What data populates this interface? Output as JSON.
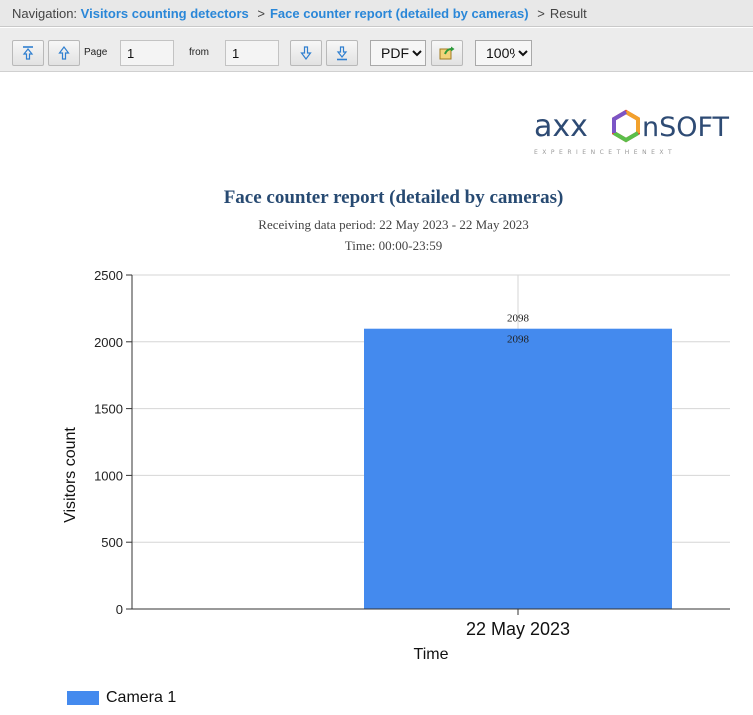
{
  "navigation": {
    "prefix": "Navigation:",
    "items": [
      "Visitors counting detectors",
      "Face counter report (detailed by cameras)"
    ],
    "separator": ">",
    "current": "Result"
  },
  "toolbar": {
    "page_label": "Page",
    "page_value": "1",
    "from_label": "from",
    "total_pages": "1",
    "format_selected": "PDF",
    "zoom_selected": "100%"
  },
  "logo": {
    "text_left": "axx",
    "text_right": "nSOFT",
    "tagline": "E X P E R I E N C E   T H E   N E X T"
  },
  "report": {
    "title": "Face counter report (detailed by cameras)",
    "period": "Receiving data period: 22 May 2023 - 22 May 2023",
    "time": "Time: 00:00-23:59"
  },
  "chart_data": {
    "type": "bar",
    "xlabel": "Time",
    "ylabel": "Visitors count",
    "categories": [
      "22 May 2023"
    ],
    "series": [
      {
        "name": "Camera 1",
        "values": [
          2098
        ],
        "color": "#448aee"
      }
    ],
    "ylim": [
      0,
      2500
    ],
    "yticks": [
      "2500",
      "2000",
      "1500",
      "1000",
      "500",
      "0"
    ],
    "data_label_top": "2098",
    "data_label_inner": "2098",
    "grid": true,
    "legend_position": "bottom-left"
  }
}
